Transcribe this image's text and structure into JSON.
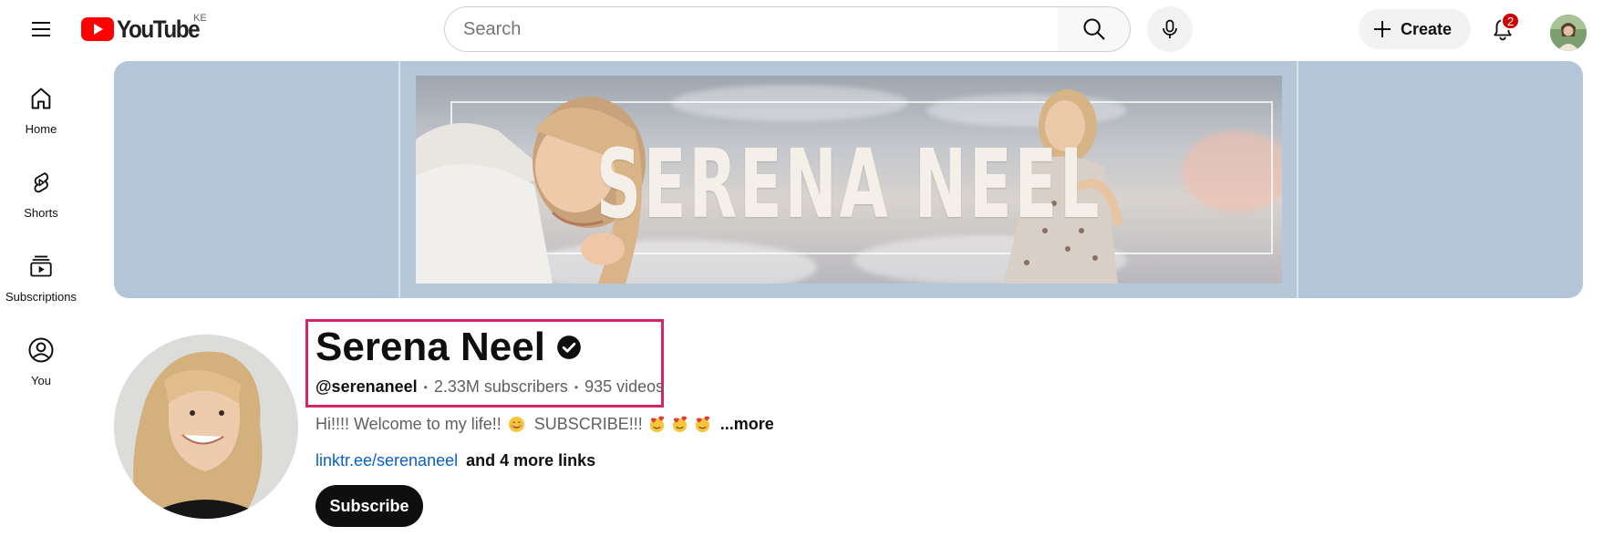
{
  "header": {
    "logo_text": "YouTube",
    "country_code": "KE",
    "search_placeholder": "Search",
    "create_label": "Create",
    "notification_count": "2",
    "brand_red": "#ff0000"
  },
  "sidebar": {
    "items": [
      {
        "label": "Home",
        "icon": "home-icon"
      },
      {
        "label": "Shorts",
        "icon": "shorts-icon"
      },
      {
        "label": "Subscriptions",
        "icon": "subscriptions-icon"
      },
      {
        "label": "You",
        "icon": "account-icon"
      }
    ]
  },
  "banner": {
    "title": "SERENA NEEL"
  },
  "channel": {
    "name": "Serena Neel",
    "verified": true,
    "handle": "@serenaneel",
    "subscribers": "2.33M subscribers",
    "videos": "935 videos",
    "description": "Hi!!!! Welcome to my life!!",
    "description_cta": "SUBSCRIBE!!!",
    "more_label": "...more",
    "primary_link": "linktr.ee/serenaneel",
    "more_links": "and 4 more links",
    "subscribe_label": "Subscribe",
    "highlight_color": "#d4246b"
  }
}
